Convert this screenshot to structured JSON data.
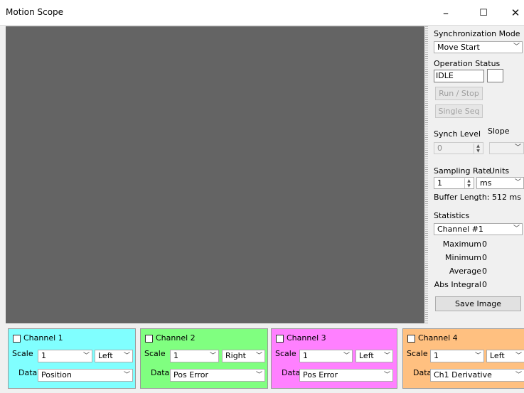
{
  "window": {
    "title": "Motion Scope",
    "minimize_glyph": "–",
    "maximize_glyph": "☐",
    "close_glyph": "✕"
  },
  "sidebar": {
    "sync_mode_label": "Synchronization Mode",
    "sync_mode_value": "Move Start",
    "operation_status_label": "Operation Status",
    "operation_status_value": "IDLE",
    "run_stop_label": "Run / Stop",
    "single_seq_label": "Single Seq",
    "synch_level_label": "Synch Level",
    "slope_label": "Slope",
    "synch_level_value": "0",
    "slope_value": "",
    "sampling_rate_label": "Sampling Rate",
    "units_label": "Units",
    "sampling_rate_value": "1",
    "units_value": "ms",
    "buffer_length_label": "Buffer Length: 512 ms",
    "statistics_label": "Statistics",
    "statistics_channel": "Channel #1",
    "maximum_label": "Maximum",
    "maximum_value": "0",
    "minimum_label": "Minimum",
    "minimum_value": "0",
    "average_label": "Average",
    "average_value": "0",
    "abs_integral_label": "Abs Integral",
    "abs_integral_value": "0",
    "save_image_label": "Save Image"
  },
  "channels": [
    {
      "title": "Channel 1",
      "scale_label": "Scale",
      "scale_value": "1",
      "side_value": "Left",
      "data_label": "Data",
      "data_value": "Position",
      "color": "#80ffff"
    },
    {
      "title": "Channel 2",
      "scale_label": "Scale",
      "scale_value": "1",
      "side_value": "Right",
      "data_label": "Data",
      "data_value": "Pos Error",
      "color": "#80ff80"
    },
    {
      "title": "Channel 3",
      "scale_label": "Scale",
      "scale_value": "1",
      "side_value": "Left",
      "data_label": "Data",
      "data_value": "Pos Error",
      "color": "#ff80ff"
    },
    {
      "title": "Channel 4",
      "scale_label": "Scale",
      "scale_value": "1",
      "side_value": "Left",
      "data_label": "Data",
      "data_value": "Ch1 Derivative",
      "color": "#ffc080"
    }
  ],
  "colors": {
    "plot_background": "#646464",
    "window_background": "#f0f0f0"
  },
  "icons": {
    "dropdown": "chevron-down-icon",
    "spinner": "spinner-arrows-icon",
    "checkbox": "checkbox-icon"
  }
}
